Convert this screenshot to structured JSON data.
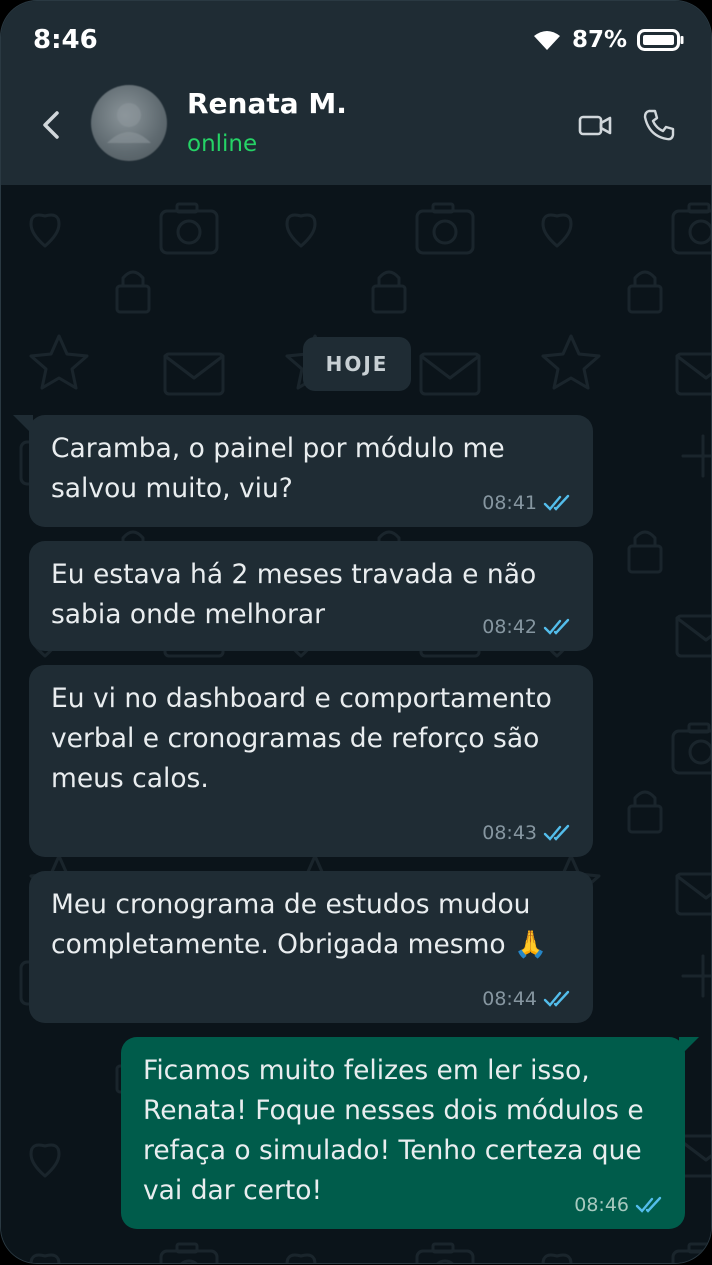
{
  "statusbar": {
    "time": "8:46",
    "battery": "87%"
  },
  "header": {
    "name": "Renata M.",
    "status": "online"
  },
  "chat": {
    "day_label": "HOJE",
    "messages": [
      {
        "direction": "in",
        "text": "Caramba, o painel por módulo me salvou muito, viu?",
        "time": "08:41"
      },
      {
        "direction": "in",
        "text": "Eu estava há 2 meses travada e não sabia onde melhorar",
        "time": "08:42"
      },
      {
        "direction": "in",
        "text": "Eu vi no dashboard e comportamento verbal e cronogramas de reforço são meus calos.",
        "time": "08:43"
      },
      {
        "direction": "in",
        "text": "Meu cronograma de estudos mudou completamente. Obrigada mesmo 🙏",
        "time": "08:44"
      },
      {
        "direction": "out",
        "text": "Ficamos muito felizes em ler isso, Renata! Foque nesses dois módulos e refaça o simulado! Tenho certeza que vai dar certo!",
        "time": "08:46"
      }
    ]
  },
  "colors": {
    "accent_online": "#25d366",
    "incoming": "#1f2c34",
    "outgoing": "#005c4b",
    "read_ticks": "#53bdeb"
  }
}
